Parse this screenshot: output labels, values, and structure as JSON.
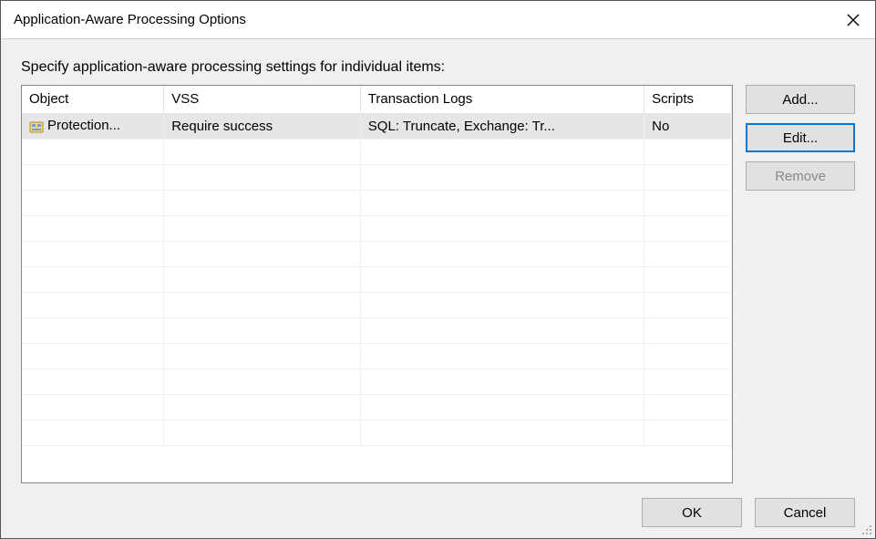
{
  "window": {
    "title": "Application-Aware Processing Options"
  },
  "instruction": "Specify application-aware processing settings for individual items:",
  "table": {
    "headers": {
      "object": "Object",
      "vss": "VSS",
      "tlogs": "Transaction Logs",
      "scripts": "Scripts"
    },
    "rows": [
      {
        "object": "Protection...",
        "vss": "Require success",
        "tlogs": "SQL: Truncate, Exchange: Tr...",
        "scripts": "No"
      }
    ]
  },
  "buttons": {
    "add": "Add...",
    "edit": "Edit...",
    "remove": "Remove",
    "ok": "OK",
    "cancel": "Cancel"
  }
}
